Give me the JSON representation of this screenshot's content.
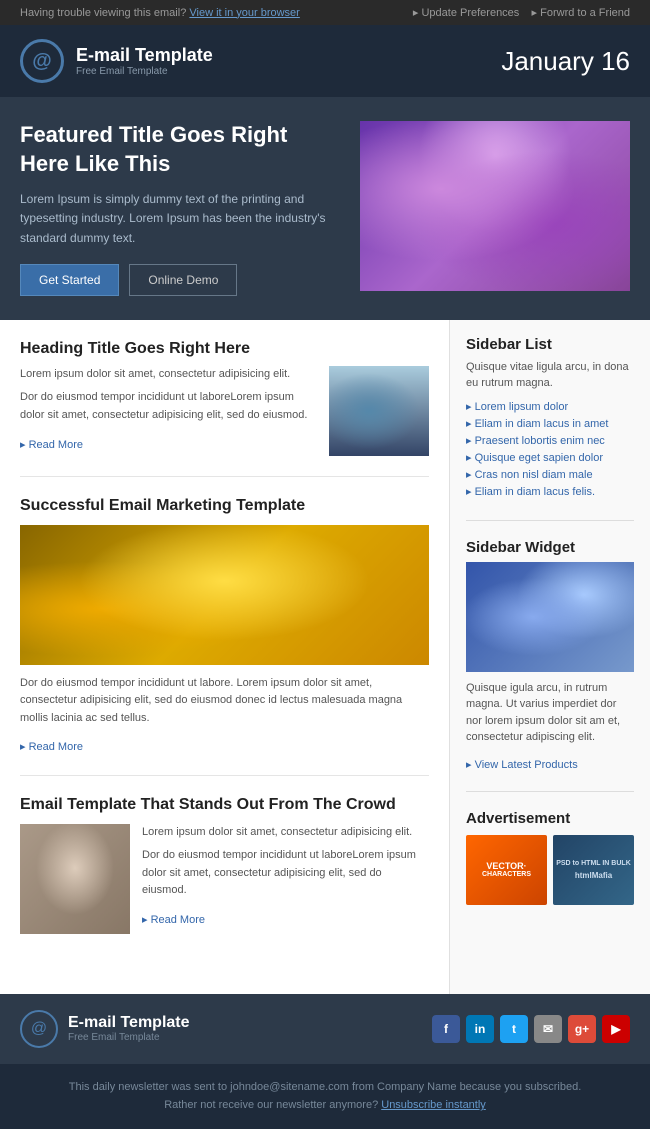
{
  "topbar": {
    "left_text": "Having trouble viewing this email?",
    "left_link": "View it in your browser",
    "right_link1": "Update Preferences",
    "right_link2": "Forwrd to a Friend"
  },
  "header": {
    "logo_title": "E-mail Template",
    "logo_sub": "Free Email Template",
    "date": "January 16"
  },
  "hero": {
    "title": "Featured Title Goes Right Here Like This",
    "body": "Lorem Ipsum is simply dummy text of the printing and typesetting industry. Lorem Ipsum has been the industry's standard dummy text.",
    "btn_primary": "Get Started",
    "btn_secondary": "Online Demo"
  },
  "article1": {
    "title": "Heading Title Goes Right Here",
    "para1": "Lorem ipsum dolor sit amet, consectetur adipisicing elit.",
    "para2": "Dor do eiusmod tempor incididunt ut laboreLorem ipsum dolor sit amet, consectetur adipisicing elit, sed do eiusmod.",
    "read_more": "Read More"
  },
  "article2": {
    "title": "Successful Email Marketing Template",
    "body": "Dor do eiusmod tempor incididunt ut labore. Lorem ipsum dolor sit amet, consectetur adipisicing elit, sed do eiusmod donec id lectus malesuada magna mollis lacinia ac sed tellus.",
    "read_more": "Read More"
  },
  "article3": {
    "title": "Email Template That Stands Out From The Crowd",
    "para1": "Lorem ipsum dolor sit amet, consectetur adipisicing elit.",
    "para2": "Dor do eiusmod tempor incididunt ut laboreLorem ipsum dolor sit amet, consectetur adipisicing elit, sed do eiusmod.",
    "read_more": "Read More"
  },
  "sidebar_list": {
    "title": "Sidebar List",
    "intro": "Quisque vitae ligula arcu, in dona eu rutrum magna.",
    "items": [
      "Lorem lipsum dolor",
      "Eliam in diam lacus in amet",
      "Praesent lobortis enim nec",
      "Quisque eget sapien dolor",
      "Cras non nisl diam male",
      "Eliam in diam lacus felis."
    ]
  },
  "sidebar_widget": {
    "title": "Sidebar Widget",
    "body": "Quisque igula arcu, in rutrum magna. Ut varius imperdiet dor nor lorem ipsum dolor sit am et, consectetur adipiscing elit.",
    "link": "View Latest Products"
  },
  "advertisement": {
    "title": "Advertisement",
    "ad1_line1": "VECTOR·",
    "ad1_line2": "CHARACTERS",
    "ad2_line1": "PSD to HTML IN BULK",
    "ad2_line2": "htmlMafia"
  },
  "footer": {
    "logo_title": "E-mail Template",
    "logo_sub": "Free Email Template",
    "social": [
      "f",
      "in",
      "t",
      "✉",
      "g+",
      "▶"
    ],
    "bottom_line1": "This daily newsletter was sent to johndoe@sitename.com from Company Name because you subscribed.",
    "bottom_line2": "Rather not receive our newsletter anymore?",
    "unsubscribe": "Unsubscribe instantly"
  }
}
